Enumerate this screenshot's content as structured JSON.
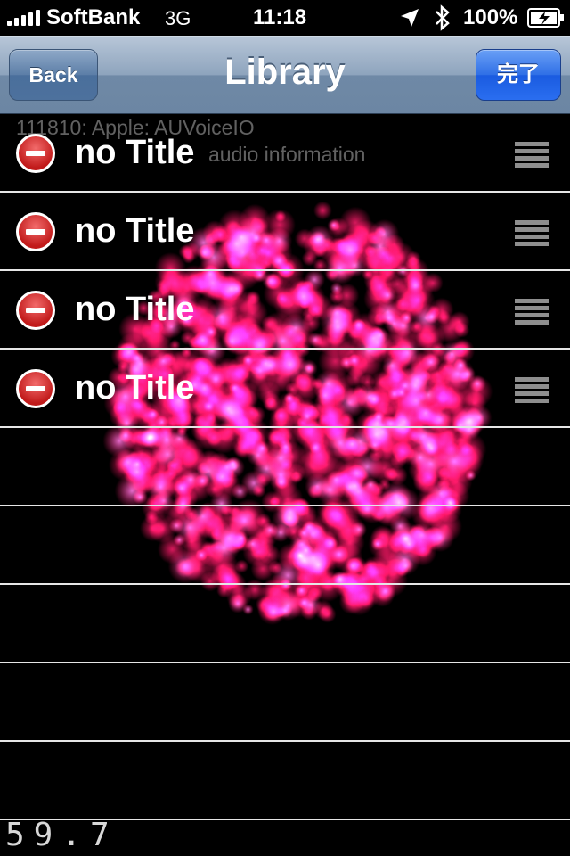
{
  "status_bar": {
    "carrier": "SoftBank",
    "network": "3G",
    "time": "11:18",
    "battery_percent": "100%",
    "signal_bars": 5,
    "icons": [
      "signal-icon",
      "location-arrow-icon",
      "bluetooth-icon",
      "battery-charging-icon"
    ]
  },
  "nav": {
    "back_label": "Back",
    "title": "Library",
    "done_label": "完了"
  },
  "background_text": {
    "line1": "111810: Apple: AUVoiceIO",
    "line2_partial": "audio information"
  },
  "rows": [
    {
      "title": "no Title"
    },
    {
      "title": "no Title"
    },
    {
      "title": "no Title"
    },
    {
      "title": "no Title"
    }
  ],
  "empty_row_count": 5,
  "fps_readout": "59.7",
  "colors": {
    "particle": "#ff1a6a",
    "done_button": "#2a6ef0",
    "nav_bar": "#8ea4bd",
    "delete_icon": "#c11a1a"
  }
}
